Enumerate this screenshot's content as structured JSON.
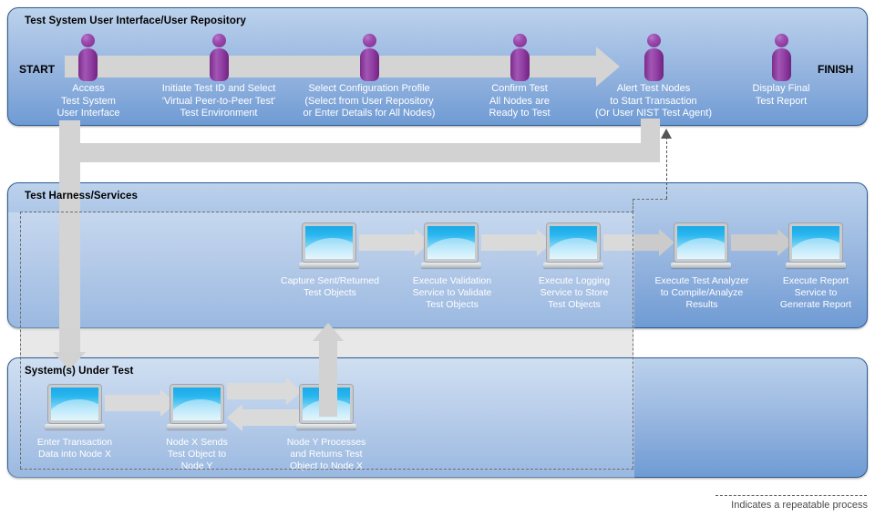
{
  "legend": {
    "text": "Indicates a repeatable process",
    "dash_color": "#555555"
  },
  "markers": {
    "start": "START",
    "finish": "FINISH"
  },
  "panels": [
    {
      "id": "test-system-ui",
      "title": "Test System User Interface/User Repository",
      "steps": [
        {
          "icon": "person-icon",
          "label": "Access\nTest System\nUser Interface"
        },
        {
          "icon": "person-icon",
          "label": "Initiate Test ID and Select\n'Virtual Peer-to-Peer Test'\nTest Environment"
        },
        {
          "icon": "person-icon",
          "label": "Select Configuration Profile\n(Select from User Repository\nor Enter Details for All Nodes)"
        },
        {
          "icon": "person-icon",
          "label": "Confirm Test\nAll Nodes are\nReady to Test"
        },
        {
          "icon": "person-icon",
          "label": "Alert Test Nodes\nto Start Transaction\n(Or User NIST Test Agent)"
        },
        {
          "icon": "person-icon",
          "label": "Display Final\nTest Report"
        }
      ]
    },
    {
      "id": "test-harness-services",
      "title": "Test Harness/Services",
      "steps": [
        {
          "icon": "laptop-icon",
          "label": "Capture Sent/Returned\nTest Objects"
        },
        {
          "icon": "laptop-icon",
          "label": "Execute Validation\nService to Validate\nTest Objects"
        },
        {
          "icon": "laptop-icon",
          "label": "Execute Logging\nService to Store\nTest Objects"
        },
        {
          "icon": "laptop-icon",
          "label": "Execute Test Analyzer\nto Compile/Analyze\nResults"
        },
        {
          "icon": "laptop-icon",
          "label": "Execute Report\nService to\nGenerate Report"
        }
      ]
    },
    {
      "id": "systems-under-test",
      "title": "System(s) Under Test",
      "steps": [
        {
          "icon": "laptop-icon",
          "label": "Enter Transaction\nData into Node X"
        },
        {
          "icon": "laptop-icon",
          "label": "Node X Sends\nTest Object to\nNode Y"
        },
        {
          "icon": "laptop-icon",
          "label": "Node Y Processes\nand Returns Test\nObject to Node X"
        }
      ]
    }
  ],
  "colors": {
    "panel_top": "#bcd2ec",
    "panel_bottom": "#6f9bd4",
    "panel_border": "#2e5d94",
    "person": "#8e3a9f",
    "laptop_screen": "#1ba9e8",
    "connector": "#d2d2d2",
    "label_text": "#ffffff"
  }
}
